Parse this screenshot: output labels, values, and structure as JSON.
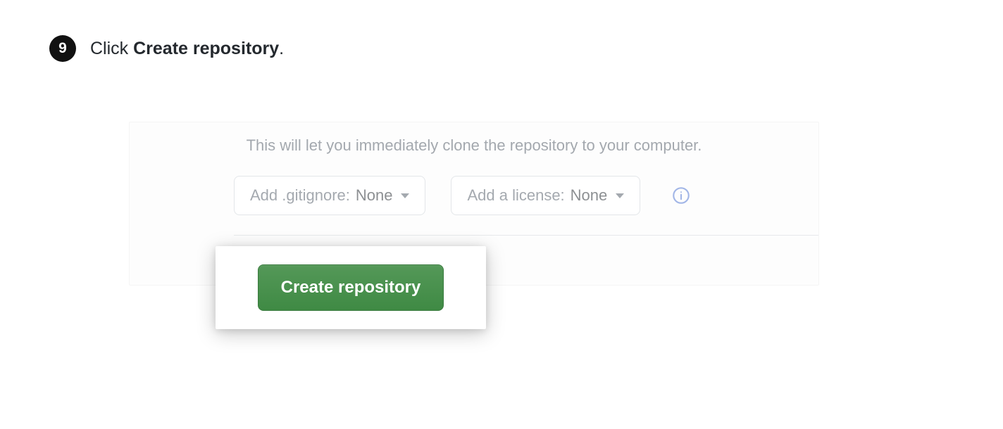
{
  "step": {
    "number": "9",
    "prefix": "Click ",
    "bold": "Create repository",
    "suffix": "."
  },
  "panel": {
    "hint": "This will let you immediately clone the repository to your computer.",
    "gitignore": {
      "label": "Add .gitignore: ",
      "value": "None"
    },
    "license": {
      "label": "Add a license: ",
      "value": "None"
    },
    "create_button": "Create repository"
  }
}
